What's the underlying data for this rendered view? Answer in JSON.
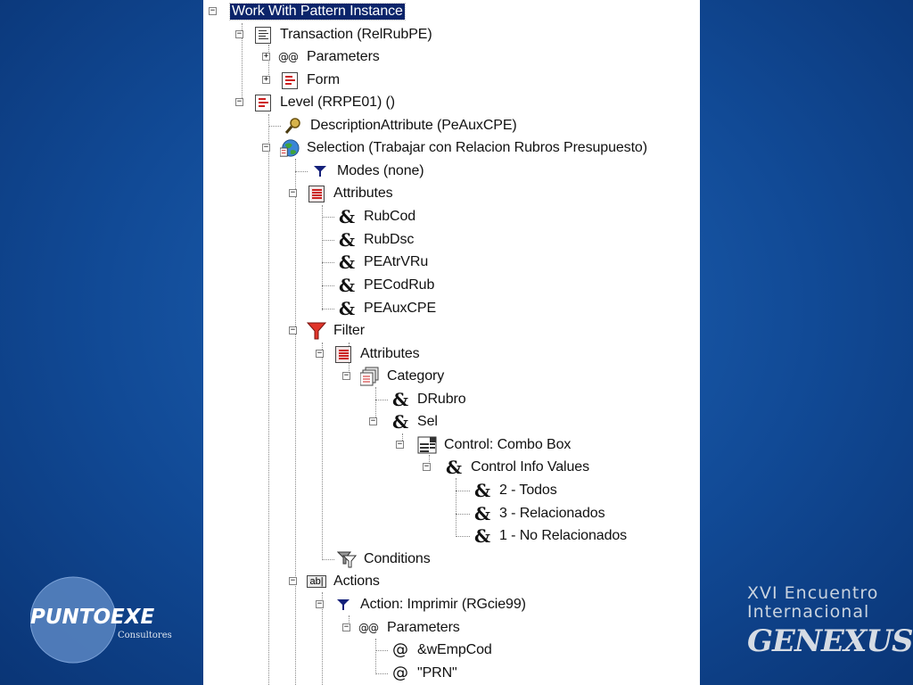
{
  "tree": {
    "nodes": [
      {
        "label": "Work With Pattern Instance",
        "icon": "none",
        "selected": true
      },
      {
        "label": "Transaction (RelRubPE)",
        "icon": "transaction-icon"
      },
      {
        "label": "Parameters",
        "icon": "parameters-icon"
      },
      {
        "label": "Form",
        "icon": "form-icon"
      },
      {
        "label": "Level (RRPE01) ()",
        "icon": "level-icon"
      },
      {
        "label": "DescriptionAttribute (PeAuxCPE)",
        "icon": "magnifier-icon"
      },
      {
        "label": "Selection (Trabajar con Relacion Rubros Presupuesto)",
        "icon": "globe-icon"
      },
      {
        "label": "Modes (none)",
        "icon": "modes-icon"
      },
      {
        "label": "Attributes",
        "icon": "attributes-icon"
      },
      {
        "label": "RubCod",
        "icon": "attribute-icon"
      },
      {
        "label": "RubDsc",
        "icon": "attribute-icon"
      },
      {
        "label": "PEAtrVRu",
        "icon": "attribute-icon"
      },
      {
        "label": "PECodRub",
        "icon": "attribute-icon"
      },
      {
        "label": "PEAuxCPE",
        "icon": "attribute-icon"
      },
      {
        "label": "Filter",
        "icon": "filter-icon"
      },
      {
        "label": "Attributes",
        "icon": "attributes-icon"
      },
      {
        "label": "Category",
        "icon": "category-icon"
      },
      {
        "label": "DRubro",
        "icon": "attribute-icon"
      },
      {
        "label": "Sel",
        "icon": "attribute-icon"
      },
      {
        "label": "Control: Combo Box",
        "icon": "combo-box-icon"
      },
      {
        "label": "Control Info Values",
        "icon": "attribute-icon"
      },
      {
        "label": "2 - Todos",
        "icon": "attribute-icon"
      },
      {
        "label": "3 - Relacionados",
        "icon": "attribute-icon"
      },
      {
        "label": "1 - No Relacionados",
        "icon": "attribute-icon"
      },
      {
        "label": "Conditions",
        "icon": "conditions-icon"
      },
      {
        "label": "Actions",
        "icon": "actions-icon"
      },
      {
        "label": "Action: Imprimir (RGcie99)",
        "icon": "modes-icon"
      },
      {
        "label": "Parameters",
        "icon": "parameters-icon"
      },
      {
        "label": "&wEmpCod",
        "icon": "parameter-icon"
      },
      {
        "label": "\"PRN\"",
        "icon": "parameter-icon"
      }
    ]
  },
  "branding": {
    "left_logo": {
      "name": "PUNTOEXE",
      "subtitle": "Consultores"
    },
    "right_logo": {
      "line1": "XVI Encuentro",
      "line2": "Internacional",
      "product": "GENEXUS"
    }
  },
  "colors": {
    "background": "#114a96",
    "selection": "#0b246a",
    "panel": "#ffffff"
  }
}
